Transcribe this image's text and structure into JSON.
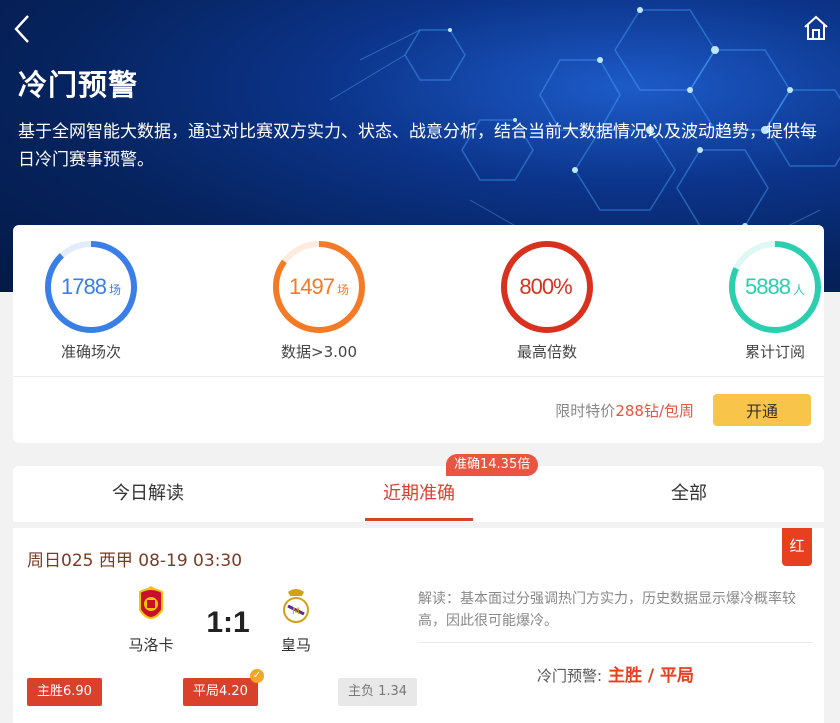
{
  "header": {
    "title": "冷门预警",
    "description": "基于全网智能大数据，通过对比赛双方实力、状态、战意分析，结合当前大数据情况以及波动趋势，提供每日冷门赛事预警。"
  },
  "stats": [
    {
      "value": "1788",
      "unit": "场",
      "label": "准确场次",
      "color": "#3a7ee8",
      "fill": 0.88
    },
    {
      "value": "1497",
      "unit": "场",
      "label": "数据>3.00",
      "color": "#f57a25",
      "fill": 0.85
    },
    {
      "value": "800%",
      "unit": "",
      "label": "最高倍数",
      "color": "#d8321e",
      "fill": 1.0
    },
    {
      "value": "5888",
      "unit": "人",
      "label": "累计订阅",
      "color": "#2bcfb0",
      "fill": 0.82
    }
  ],
  "offer": {
    "prefix": "限时特价",
    "price": "288钻/包周",
    "button": "开通"
  },
  "tabs": {
    "items": [
      "今日解读",
      "近期准确",
      "全部"
    ],
    "active_index": 1,
    "badge": "准确14.35倍"
  },
  "match": {
    "title": "周日025 西甲 08-19 03:30",
    "result_tag": "红",
    "home": "马洛卡",
    "away": "皇马",
    "score": "1:1",
    "analysis": "解读：基本面过分强调热门方实力，历史数据显示爆冷概率较高，因此很可能爆冷。",
    "predict_label": "冷门预警:",
    "predict_result": "主胜 / 平局",
    "odds": {
      "home": "主胜6.90",
      "draw": "平局4.20",
      "away": "主负 1.34"
    }
  },
  "colors": {
    "accent": "#d8412d",
    "button": "#f9c44a"
  }
}
